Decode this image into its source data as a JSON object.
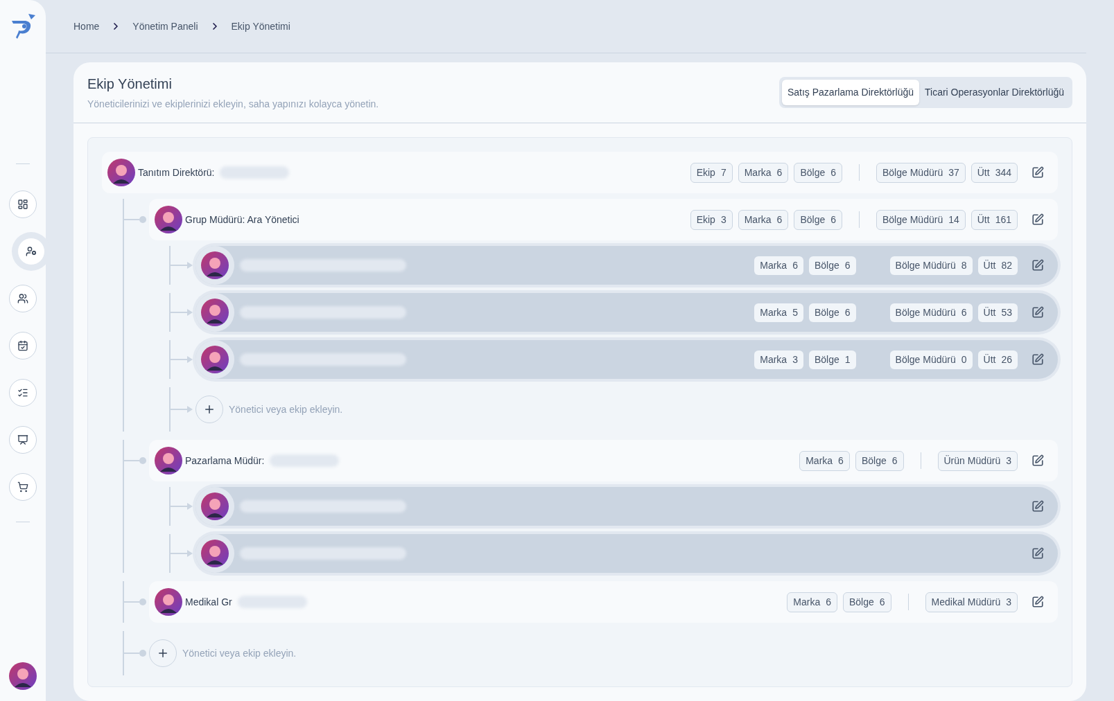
{
  "sidebar": {
    "items": [
      {
        "kind": "dashboard",
        "selected": false
      },
      {
        "kind": "user-settings",
        "selected": true
      },
      {
        "kind": "users",
        "selected": false
      },
      {
        "kind": "calendar",
        "selected": false
      },
      {
        "kind": "checklist",
        "selected": false
      },
      {
        "kind": "presentation",
        "selected": false
      },
      {
        "kind": "cart",
        "selected": false
      }
    ]
  },
  "breadcrumbs": [
    "Home",
    "Yönetim Paneli",
    "Ekip Yönetimi"
  ],
  "page": {
    "title": "Ekip Yönetimi",
    "subtitle": "Yöneticilerinizi ve ekiplerinizi ekleyin, saha yapınızı kolayca yönetin."
  },
  "tabs": [
    {
      "label": "Satış Pazarlama Direktörlüğü",
      "selected": true
    },
    {
      "label": "Ticari Operasyonlar Direktörlüğü",
      "selected": false
    }
  ],
  "tree": {
    "kind": "manager",
    "title": "Tanıtım Direktörü:",
    "redacted": true,
    "stats": [
      {
        "label": "Ekip",
        "value": "7"
      },
      {
        "label": "Marka",
        "value": "6"
      },
      {
        "label": "Bölge",
        "value": "6"
      }
    ],
    "roles": [
      {
        "label": "Bölge Müdürü",
        "value": "37"
      },
      {
        "label": "Ütt",
        "value": "344"
      }
    ],
    "add_label": "Yönetici veya ekip ekleyin.",
    "children": [
      {
        "kind": "manager",
        "title": "Grup Müdürü: Ara Yönetici",
        "redacted": false,
        "stats": [
          {
            "label": "Ekip",
            "value": "3"
          },
          {
            "label": "Marka",
            "value": "6"
          },
          {
            "label": "Bölge",
            "value": "6"
          }
        ],
        "roles": [
          {
            "label": "Bölge Müdürü",
            "value": "14"
          },
          {
            "label": "Ütt",
            "value": "161"
          }
        ],
        "add_label": "Yönetici veya ekip ekleyin.",
        "children": [
          {
            "kind": "team",
            "redacted": true,
            "stats": [
              {
                "label": "Marka",
                "value": "6"
              },
              {
                "label": "Bölge",
                "value": "6"
              }
            ],
            "roles": [
              {
                "label": "Bölge Müdürü",
                "value": "8"
              },
              {
                "label": "Ütt",
                "value": "82"
              }
            ]
          },
          {
            "kind": "team",
            "redacted": true,
            "stats": [
              {
                "label": "Marka",
                "value": "5"
              },
              {
                "label": "Bölge",
                "value": "6"
              }
            ],
            "roles": [
              {
                "label": "Bölge Müdürü",
                "value": "6"
              },
              {
                "label": "Ütt",
                "value": "53"
              }
            ]
          },
          {
            "kind": "team",
            "redacted": true,
            "stats": [
              {
                "label": "Marka",
                "value": "3"
              },
              {
                "label": "Bölge",
                "value": "1"
              }
            ],
            "roles": [
              {
                "label": "Bölge Müdürü",
                "value": "0"
              },
              {
                "label": "Ütt",
                "value": "26"
              }
            ]
          }
        ]
      },
      {
        "kind": "manager",
        "title": "Pazarlama Müdür:",
        "redacted": true,
        "stats": [
          {
            "label": "Marka",
            "value": "6"
          },
          {
            "label": "Bölge",
            "value": "6"
          }
        ],
        "roles": [
          {
            "label": "Ürün Müdürü",
            "value": "3"
          }
        ],
        "children": [
          {
            "kind": "team",
            "redacted": true
          },
          {
            "kind": "team",
            "redacted": true
          }
        ]
      },
      {
        "kind": "manager",
        "title": "Medikal Gr",
        "redacted": true,
        "stats": [
          {
            "label": "Marka",
            "value": "6"
          },
          {
            "label": "Bölge",
            "value": "6"
          }
        ],
        "roles": [
          {
            "label": "Medikal Müdürü",
            "value": "3"
          }
        ]
      }
    ]
  }
}
